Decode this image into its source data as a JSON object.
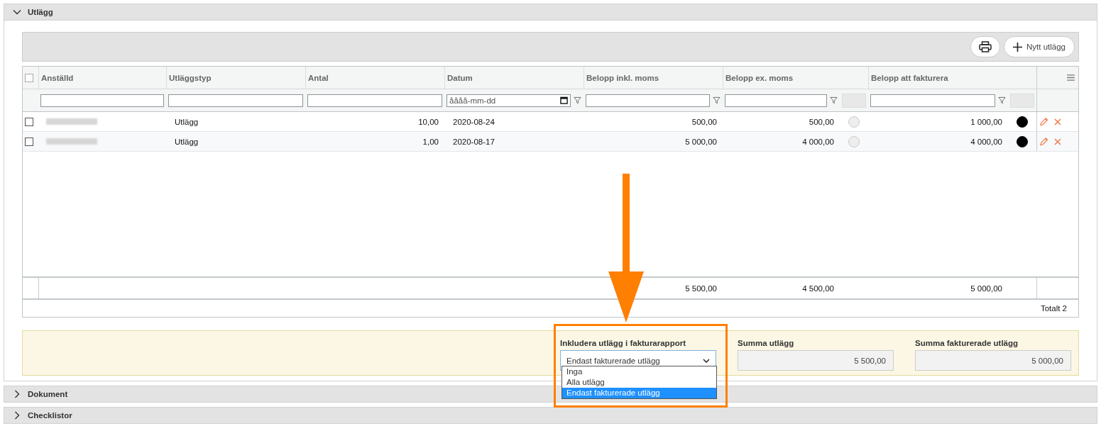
{
  "panels": [
    {
      "title": "Utlägg",
      "expanded": true
    },
    {
      "title": "Dokument",
      "expanded": false
    },
    {
      "title": "Checklistor",
      "expanded": false
    }
  ],
  "toolbar": {
    "new_button": "Nytt utlägg"
  },
  "table": {
    "select_all_checked": false,
    "columns": [
      "Anställd",
      "Utläggstyp",
      "Antal",
      "Datum",
      "Belopp inkl. moms",
      "Belopp ex. moms",
      "Belopp att fakturera"
    ],
    "date_filter_placeholder": "åååå-mm-dd",
    "rows": [
      {
        "checked": false,
        "type": "Utlägg",
        "quantity": "10,00",
        "date": "2020-08-24",
        "amount_incl_vat": "500,00",
        "amount_excl_vat": "500,00",
        "circle_filled": false,
        "amount_to_invoice": "1 000,00",
        "dot_filled": true
      },
      {
        "checked": false,
        "type": "Utlägg",
        "quantity": "1,00",
        "date": "2020-08-17",
        "amount_incl_vat": "5 000,00",
        "amount_excl_vat": "4 000,00",
        "circle_filled": false,
        "amount_to_invoice": "4 000,00",
        "dot_filled": true
      }
    ],
    "totals": {
      "amount_incl_vat": "5 500,00",
      "amount_excl_vat": "4 500,00",
      "amount_to_invoice": "5 000,00"
    },
    "count": "Totalt 2"
  },
  "summary": {
    "include_label": "Inkludera utlägg i fakturarapport",
    "include_value": "Endast fakturerade utlägg",
    "options": [
      {
        "label": "Inga",
        "selected": false
      },
      {
        "label": "Alla utlägg",
        "selected": false
      },
      {
        "label": "Endast fakturerade utlägg",
        "selected": true
      }
    ],
    "sum_label": "Summa utlägg",
    "sum_value": "5 500,00",
    "invoiced_label": "Summa fakturerade utlägg",
    "invoiced_value": "5 000,00"
  }
}
